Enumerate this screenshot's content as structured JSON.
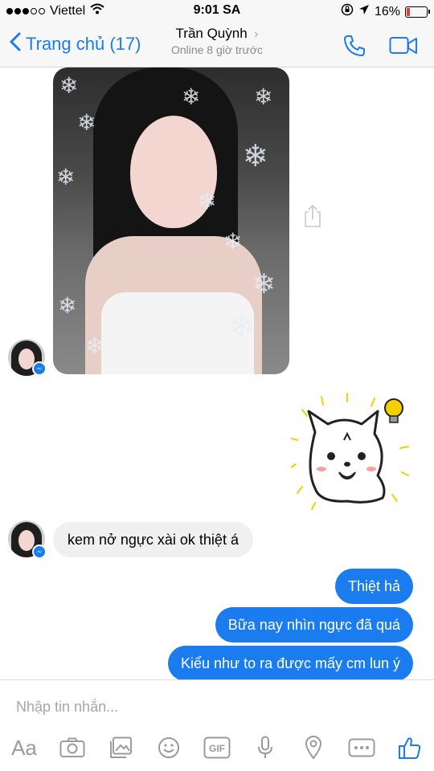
{
  "status_bar": {
    "carrier": "Viettel",
    "time": "9:01 SA",
    "battery": "16%",
    "battery_level": 0.16,
    "battery_color": "#e53b30"
  },
  "nav": {
    "back_label": "Trang chủ (17)",
    "contact_name": "Trần Quỳnh",
    "contact_status": "Online 8 giờ trước",
    "icons": [
      "chevron-left-icon",
      "chevron-right-icon",
      "phone-icon",
      "video-camera-icon"
    ]
  },
  "messages": {
    "incoming_text": "kem nở ngực xài ok thiệt á",
    "outgoing": [
      {
        "text": "Thiệt hả"
      },
      {
        "text": "Bữa nay nhìn ngực đã quá"
      },
      {
        "text": "Kiểu như to ra được mấy cm lun ý"
      }
    ]
  },
  "composer": {
    "placeholder": "Nhập tin nhắn...",
    "aa_label": "Aa",
    "gif_label": "GIF",
    "tools": [
      "text-format-icon",
      "camera-icon",
      "gallery-icon",
      "emoji-icon",
      "gif-icon",
      "microphone-icon",
      "location-icon",
      "more-icon",
      "like-icon"
    ]
  },
  "colors": {
    "accent": "#1b7cf0",
    "incoming_bubble": "#f1f0f0",
    "outgoing_bubble": "#1b7cf0",
    "bar_background": "#f7f7f7"
  }
}
